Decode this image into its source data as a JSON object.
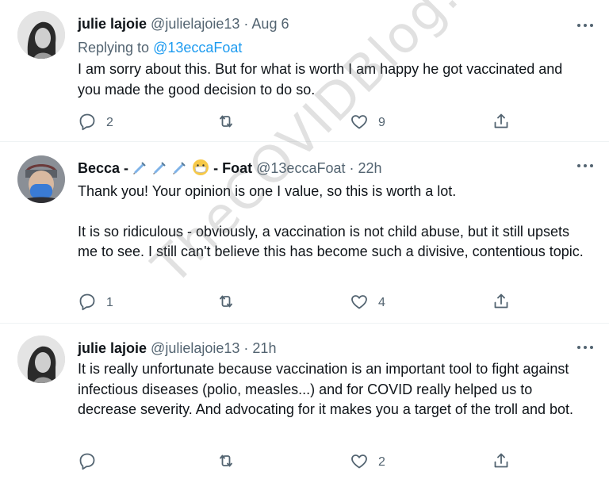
{
  "watermark": "TheCOVIDBlog.com",
  "tweets": [
    {
      "name": "julie lajoie",
      "handle": "@julielajoie13",
      "separator": "·",
      "time": "Aug 6",
      "reply_prefix": "Replying to",
      "reply_handle": "@13eccaFoat",
      "paragraphs": [
        "I am sorry about this. But for what is worth I am happy he got vaccinated and you made the good decision to do so."
      ],
      "actions": {
        "replies": "2",
        "retweets": "",
        "likes": "9",
        "share": ""
      }
    },
    {
      "name_prefix": "Becca -",
      "name_suffix": "- Foat",
      "handle": "@13eccaFoat",
      "separator": "·",
      "time": "22h",
      "paragraphs": [
        "Thank you! Your opinion is one I value, so this is worth a lot.",
        "It is so ridiculous - obviously, a vaccination is not child abuse, but it still upsets me to see. I still can't believe this has become such a divisive, contentious topic."
      ],
      "actions": {
        "replies": "1",
        "retweets": "",
        "likes": "4",
        "share": ""
      }
    },
    {
      "name": "julie lajoie",
      "handle": "@julielajoie13",
      "separator": "·",
      "time": "21h",
      "paragraphs": [
        "It is really unfortunate because vaccination is an important tool to fight against infectious diseases (polio, measles...) and for COVID really helped us to decrease severity. And advocating for it makes you a target of the troll and bot."
      ],
      "actions": {
        "replies": "",
        "retweets": "",
        "likes": "2",
        "share": ""
      }
    }
  ],
  "colors": {
    "text": "#0f1419",
    "muted": "#536471",
    "link": "#1d9bf0",
    "divider": "#eff3f4"
  },
  "icons": [
    "reply-icon",
    "retweet-icon",
    "like-icon",
    "share-icon",
    "more-icon",
    "syringe-icon",
    "mask-face-icon"
  ]
}
